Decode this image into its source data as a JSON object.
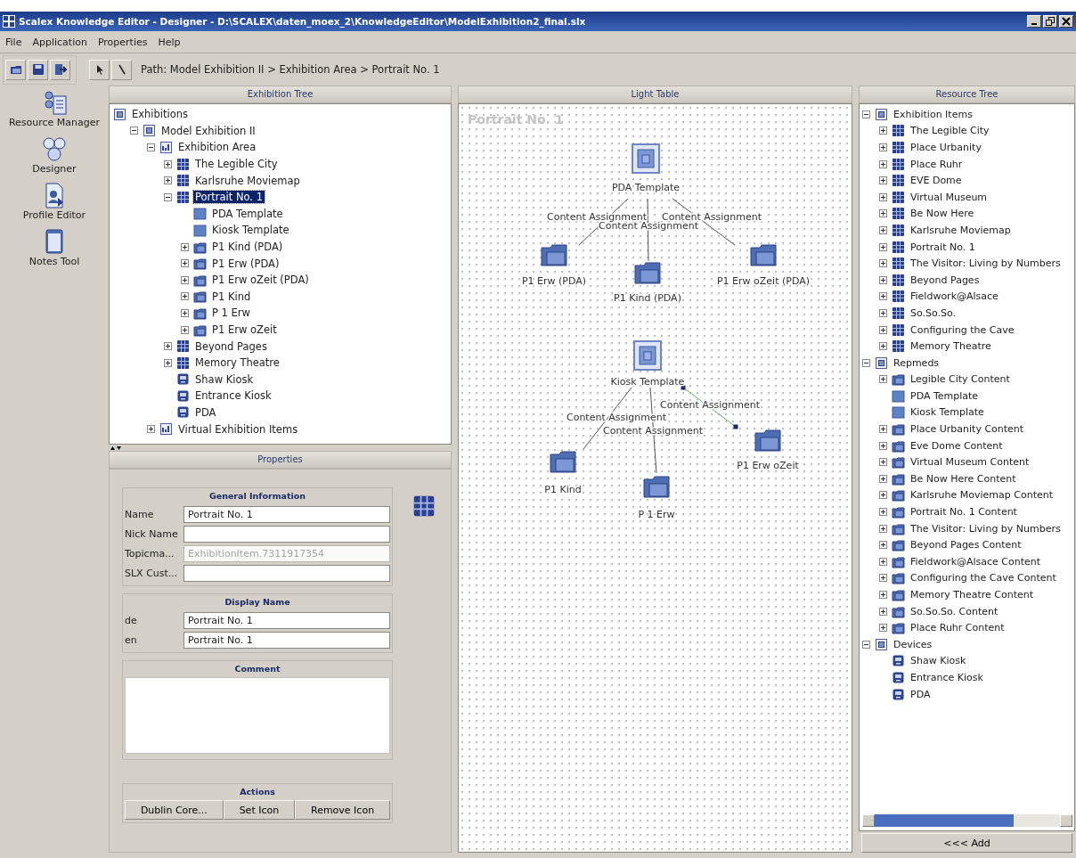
{
  "window": {
    "title": "Scalex Knowledge Editor - Designer - D:\\SCALEX\\daten_moex_2\\KnowledgeEditor\\ModelExhibition2_final.slx"
  },
  "menu": [
    "File",
    "Application",
    "Properties",
    "Help"
  ],
  "toolbar": {
    "path": "Path: Model Exhibition II > Exhibition Area > Portrait No. 1"
  },
  "tools": [
    {
      "label": "Resource Manager",
      "kind": "resources"
    },
    {
      "label": "Designer",
      "kind": "designer"
    },
    {
      "label": "Profile Editor",
      "kind": "profile"
    },
    {
      "label": "Notes Tool",
      "kind": "notes"
    }
  ],
  "exhibition_tree": {
    "title": "Exhibition Tree",
    "items": [
      {
        "label": "Exhibitions",
        "kind": "category",
        "selected": false,
        "children": [
          {
            "label": "Model Exhibition II",
            "kind": "category",
            "expanded": true,
            "selected": false,
            "children": [
              {
                "label": "Exhibition Area",
                "kind": "area",
                "expanded": true,
                "selected": false,
                "children": [
                  {
                    "label": "The Legible City",
                    "kind": "item",
                    "expanded": false,
                    "selected": false
                  },
                  {
                    "label": "Karlsruhe Moviemap",
                    "kind": "item",
                    "expanded": false,
                    "selected": false
                  },
                  {
                    "label": "Portrait No. 1",
                    "kind": "item",
                    "expanded": true,
                    "selected": true,
                    "children": [
                      {
                        "label": "PDA Template",
                        "kind": "template",
                        "selected": false
                      },
                      {
                        "label": "Kiosk Template",
                        "kind": "template",
                        "selected": false
                      },
                      {
                        "label": "P1 Kind (PDA)",
                        "kind": "content",
                        "expanded": false,
                        "selected": false
                      },
                      {
                        "label": "P1 Erw (PDA)",
                        "kind": "content",
                        "expanded": false,
                        "selected": false
                      },
                      {
                        "label": "P1 Erw oZeit  (PDA)",
                        "kind": "content",
                        "expanded": false,
                        "selected": false
                      },
                      {
                        "label": "P1 Kind",
                        "kind": "content",
                        "expanded": false,
                        "selected": false
                      },
                      {
                        "label": "P 1 Erw",
                        "kind": "content",
                        "expanded": false,
                        "selected": false
                      },
                      {
                        "label": "P1 Erw oZeit",
                        "kind": "content",
                        "expanded": false,
                        "selected": false
                      }
                    ]
                  },
                  {
                    "label": "Beyond Pages",
                    "kind": "item",
                    "expanded": false,
                    "selected": false
                  },
                  {
                    "label": "Memory Theatre",
                    "kind": "item",
                    "expanded": false,
                    "selected": false
                  },
                  {
                    "label": "Shaw Kiosk",
                    "kind": "device",
                    "selected": false
                  },
                  {
                    "label": "Entrance Kiosk",
                    "kind": "device",
                    "selected": false
                  },
                  {
                    "label": "PDA",
                    "kind": "device",
                    "selected": false
                  }
                ]
              },
              {
                "label": "Virtual Exhibition Items",
                "kind": "area",
                "expanded": false,
                "selected": false
              }
            ]
          }
        ]
      }
    ]
  },
  "properties": {
    "title": "Properties",
    "general": {
      "title": "General Information",
      "fields": [
        {
          "label": "Name",
          "value": "Portrait No. 1",
          "disabled": false
        },
        {
          "label": "Nick Name",
          "disabled": false
        },
        {
          "label": "Topicma...",
          "value": "ExhibitionItem.7311917354",
          "disabled": true
        },
        {
          "label": "SLX Cust...",
          "disabled": false
        }
      ]
    },
    "display_name": {
      "title": "Display Name",
      "fields": [
        {
          "label": "de",
          "value": "Portrait No. 1",
          "disabled": false
        },
        {
          "label": "en",
          "value": "Portrait No. 1",
          "disabled": false
        }
      ]
    },
    "comment": {
      "title": "Comment"
    },
    "actions": {
      "title": "Actions",
      "buttons": [
        "Dublin Core...",
        "Set Icon",
        "Remove Icon"
      ]
    }
  },
  "light_table": {
    "title": "Light Table",
    "canvas_title": "Portrait No. 1",
    "nodes": [
      {
        "label": "PDA Template",
        "kind": "template"
      },
      {
        "label": "P1 Erw (PDA)",
        "kind": "content"
      },
      {
        "label": "P1 Kind (PDA)",
        "kind": "content"
      },
      {
        "label": "P1 Erw oZeit  (PDA)",
        "kind": "content"
      },
      {
        "label": "Kiosk Template",
        "kind": "template"
      },
      {
        "label": "P1 Kind",
        "kind": "content"
      },
      {
        "label": "P 1 Erw",
        "kind": "content"
      },
      {
        "label": "P1 Erw oZeit",
        "kind": "content"
      }
    ],
    "edges": [
      {
        "label": "Content Assignment",
        "selected": false
      },
      {
        "label": "Content Assignment",
        "selected": false
      },
      {
        "label": "Content Assignment",
        "selected": false
      },
      {
        "label": "Content Assignment",
        "selected": false
      },
      {
        "label": "Content Assignment",
        "selected": false
      },
      {
        "label": "Content Assignment",
        "selected": true
      }
    ]
  },
  "resource_tree": {
    "title": "Resource Tree",
    "items": [
      {
        "label": "Exhibition Items",
        "kind": "category",
        "expanded": true,
        "children": [
          {
            "label": "The Legible City",
            "kind": "item",
            "expanded": false
          },
          {
            "label": "Place Urbanity",
            "kind": "item",
            "expanded": false
          },
          {
            "label": "Place Ruhr",
            "kind": "item",
            "expanded": false
          },
          {
            "label": "EVE Dome",
            "kind": "item",
            "expanded": false
          },
          {
            "label": "Virtual Museum",
            "kind": "item",
            "expanded": false
          },
          {
            "label": "Be Now Here",
            "kind": "item",
            "expanded": false
          },
          {
            "label": "Karlsruhe Moviemap",
            "kind": "item",
            "expanded": false
          },
          {
            "label": "Portrait No. 1",
            "kind": "item",
            "expanded": false
          },
          {
            "label": "The Visitor: Living by Numbers",
            "kind": "item",
            "expanded": false
          },
          {
            "label": "Beyond Pages",
            "kind": "item",
            "expanded": false
          },
          {
            "label": "Fieldwork@Alsace",
            "kind": "item",
            "expanded": false
          },
          {
            "label": "So.So.So.",
            "kind": "item",
            "expanded": false
          },
          {
            "label": "Configuring the Cave",
            "kind": "item",
            "expanded": false
          },
          {
            "label": "Memory Theatre",
            "kind": "item",
            "expanded": false
          }
        ]
      },
      {
        "label": "Repmeds",
        "kind": "category",
        "expanded": true,
        "children": [
          {
            "label": "Legible City Content",
            "kind": "content",
            "expanded": false
          },
          {
            "label": "PDA Template",
            "kind": "template"
          },
          {
            "label": "Kiosk Template",
            "kind": "template"
          },
          {
            "label": "Place Urbanity Content",
            "kind": "content",
            "expanded": false
          },
          {
            "label": "Eve Dome Content",
            "kind": "content",
            "expanded": false
          },
          {
            "label": "Virtual Museum Content",
            "kind": "content",
            "expanded": false
          },
          {
            "label": "Be Now Here Content",
            "kind": "content",
            "expanded": false
          },
          {
            "label": "Karlsruhe Moviemap Content",
            "kind": "content",
            "expanded": false
          },
          {
            "label": "Portrait No. 1 Content",
            "kind": "content",
            "expanded": false
          },
          {
            "label": "The Visitor: Living by Numbers",
            "kind": "content",
            "expanded": false
          },
          {
            "label": "Beyond Pages Content",
            "kind": "content",
            "expanded": false
          },
          {
            "label": "Fieldwork@Alsace Content",
            "kind": "content",
            "expanded": false
          },
          {
            "label": "Configuring the Cave Content",
            "kind": "content",
            "expanded": false
          },
          {
            "label": "Memory Theatre Content",
            "kind": "content",
            "expanded": false
          },
          {
            "label": "So.So.So. Content",
            "kind": "content",
            "expanded": false
          },
          {
            "label": "Place Ruhr Content",
            "kind": "content",
            "expanded": false
          }
        ]
      },
      {
        "label": "Devices",
        "kind": "category",
        "expanded": true,
        "children": [
          {
            "label": "Shaw Kiosk",
            "kind": "device"
          },
          {
            "label": "Entrance Kiosk",
            "kind": "device"
          },
          {
            "label": "PDA",
            "kind": "device"
          }
        ]
      }
    ],
    "add_button": "<<< Add"
  }
}
